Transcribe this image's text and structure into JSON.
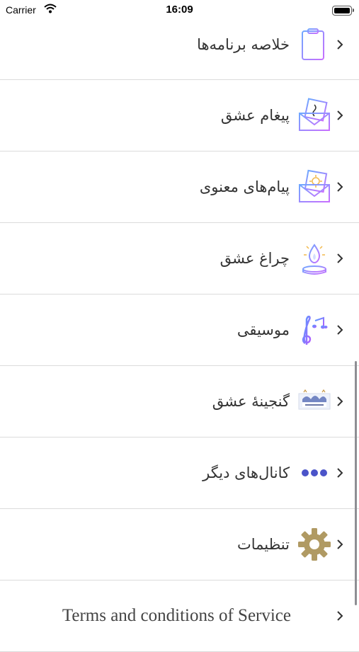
{
  "status_bar": {
    "carrier": "Carrier",
    "time": "16:09"
  },
  "menu": {
    "items": [
      {
        "label": "خلاصه برنامه‌ها",
        "icon": "clipboard-icon"
      },
      {
        "label": "پیغام عشق",
        "icon": "love-letter-icon"
      },
      {
        "label": "پیام‌های معنوی",
        "icon": "sun-envelope-icon"
      },
      {
        "label": "چراغ عشق",
        "icon": "candle-lamp-icon"
      },
      {
        "label": "موسیقی",
        "icon": "music-notes-icon"
      },
      {
        "label": "گنجینهٔ عشق",
        "icon": "treasure-banner-icon"
      },
      {
        "label": "کانال‌های دیگر",
        "icon": "three-dots-icon"
      },
      {
        "label": "تنظیمات",
        "icon": "gear-icon"
      },
      {
        "label": "Terms and conditions of Service",
        "icon": ""
      }
    ]
  },
  "colors": {
    "gear": "#b09a63",
    "dots": "#4b54c9",
    "separator": "#dcdcdc"
  }
}
